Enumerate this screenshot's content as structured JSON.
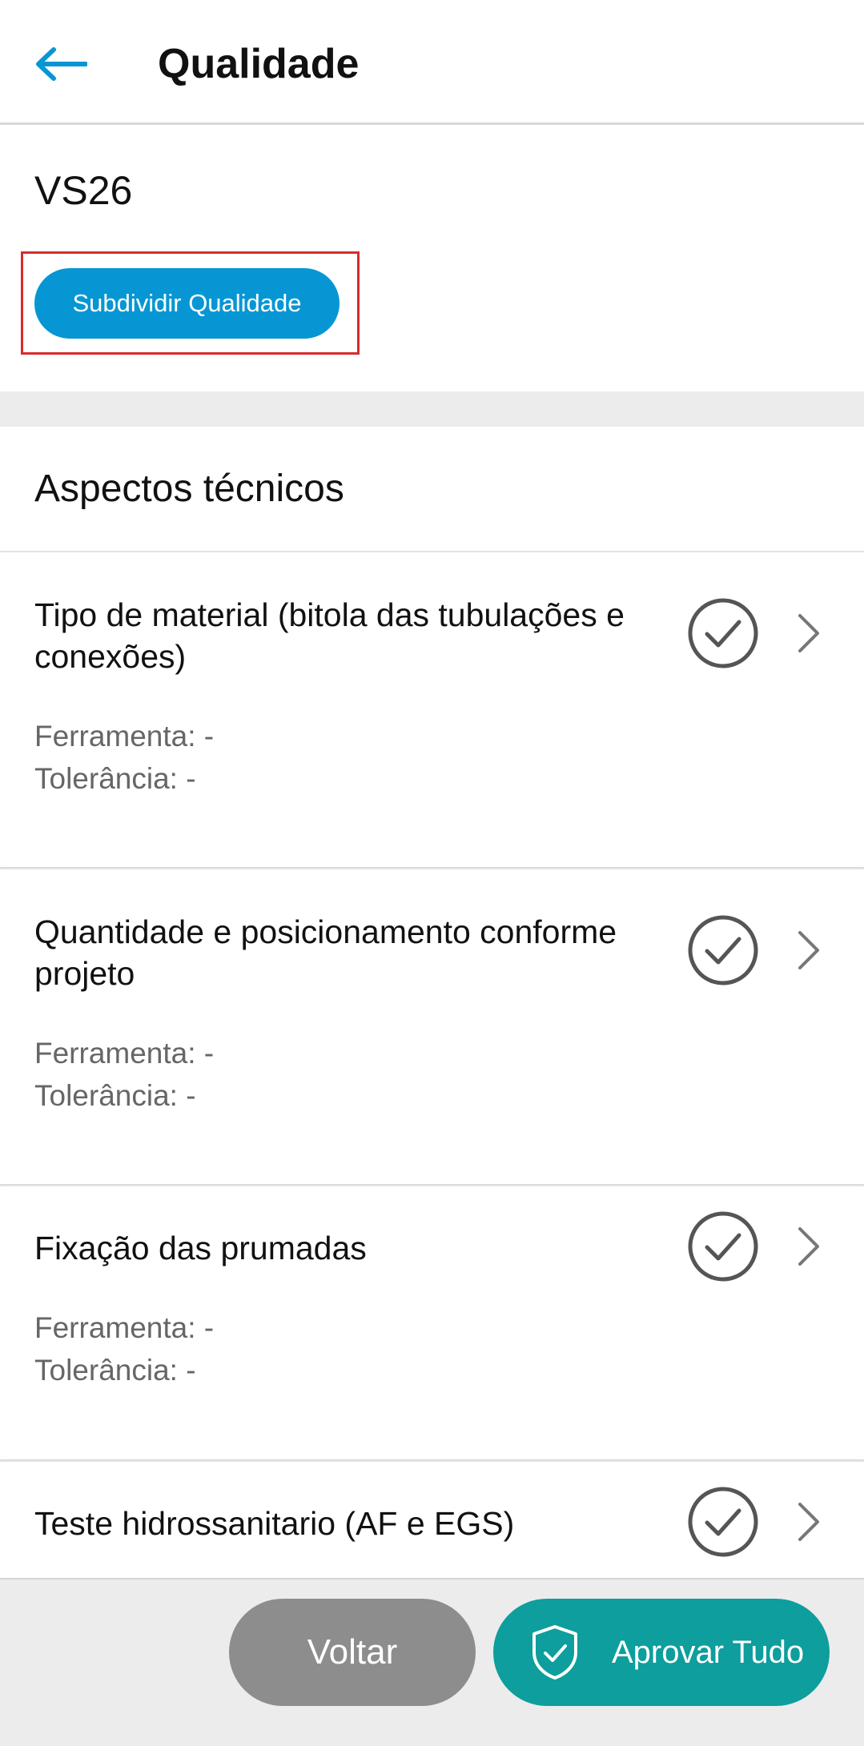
{
  "header": {
    "title": "Qualidade",
    "back_icon": "arrow-left-icon"
  },
  "item": {
    "code": "VS26",
    "subdivide_label": "Subdividir Qualidade"
  },
  "section": {
    "title": "Aspectos técnicos"
  },
  "aspects": [
    {
      "title": "Tipo de material (bitola das tubulações e conexões)",
      "ferramenta": "Ferramenta: -",
      "tolerancia": "Tolerância: -",
      "status": "approved"
    },
    {
      "title": "Quantidade e posicionamento conforme projeto",
      "ferramenta": "Ferramenta: -",
      "tolerancia": "Tolerância: -",
      "status": "approved"
    },
    {
      "title": "Fixação das prumadas",
      "ferramenta": "Ferramenta: -",
      "tolerancia": "Tolerância: -",
      "status": "approved"
    },
    {
      "title": "Teste hidrossanitario (AF e EGS)",
      "status": "approved"
    }
  ],
  "footer": {
    "back_label": "Voltar",
    "approve_all_label": "Aprovar Tudo",
    "approve_icon": "shield-check-icon"
  },
  "colors": {
    "primary": "#0796d4",
    "approve": "#0d9e9d",
    "secondary_button": "#8d8d8d",
    "highlight": "#d92b2b"
  }
}
